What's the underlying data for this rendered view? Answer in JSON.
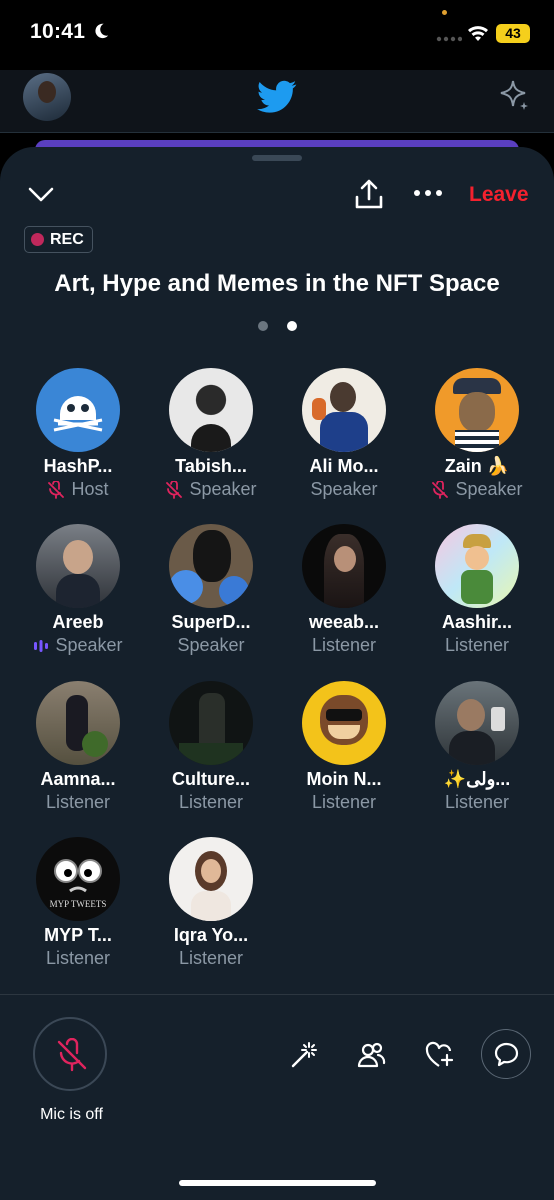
{
  "status_bar": {
    "time": "10:41",
    "battery": "43"
  },
  "space": {
    "rec_label": "REC",
    "leave_label": "Leave",
    "title": "Art, Hype and Memes in the NFT Space"
  },
  "participants": [
    {
      "name": "HashP...",
      "role": "Host",
      "muted": true
    },
    {
      "name": "Tabish...",
      "role": "Speaker",
      "muted": true
    },
    {
      "name": "Ali Mo...",
      "role": "Speaker",
      "muted": false
    },
    {
      "name": "Zain 🍌",
      "role": "Speaker",
      "muted": true
    },
    {
      "name": "Areeb",
      "role": "Speaker",
      "speaking": true
    },
    {
      "name": "SuperD...",
      "role": "Speaker",
      "muted": false
    },
    {
      "name": "weeab...",
      "role": "Listener"
    },
    {
      "name": "Aashir...",
      "role": "Listener"
    },
    {
      "name": "Aamna...",
      "role": "Listener"
    },
    {
      "name": "Culture...",
      "role": "Listener"
    },
    {
      "name": "Moin N...",
      "role": "Listener"
    },
    {
      "name": "✨ولی...",
      "role": "Listener"
    },
    {
      "name": "MYP T...",
      "role": "Listener",
      "avatar_text": "MYP TWEETS"
    },
    {
      "name": "Iqra Yo...",
      "role": "Listener"
    }
  ],
  "bottom_bar": {
    "mic_label": "Mic is off"
  },
  "colors": {
    "sheet": "#15202b",
    "leave": "#f4212e",
    "muted_icon": "#e0245e",
    "speaking": "#7856ff"
  }
}
